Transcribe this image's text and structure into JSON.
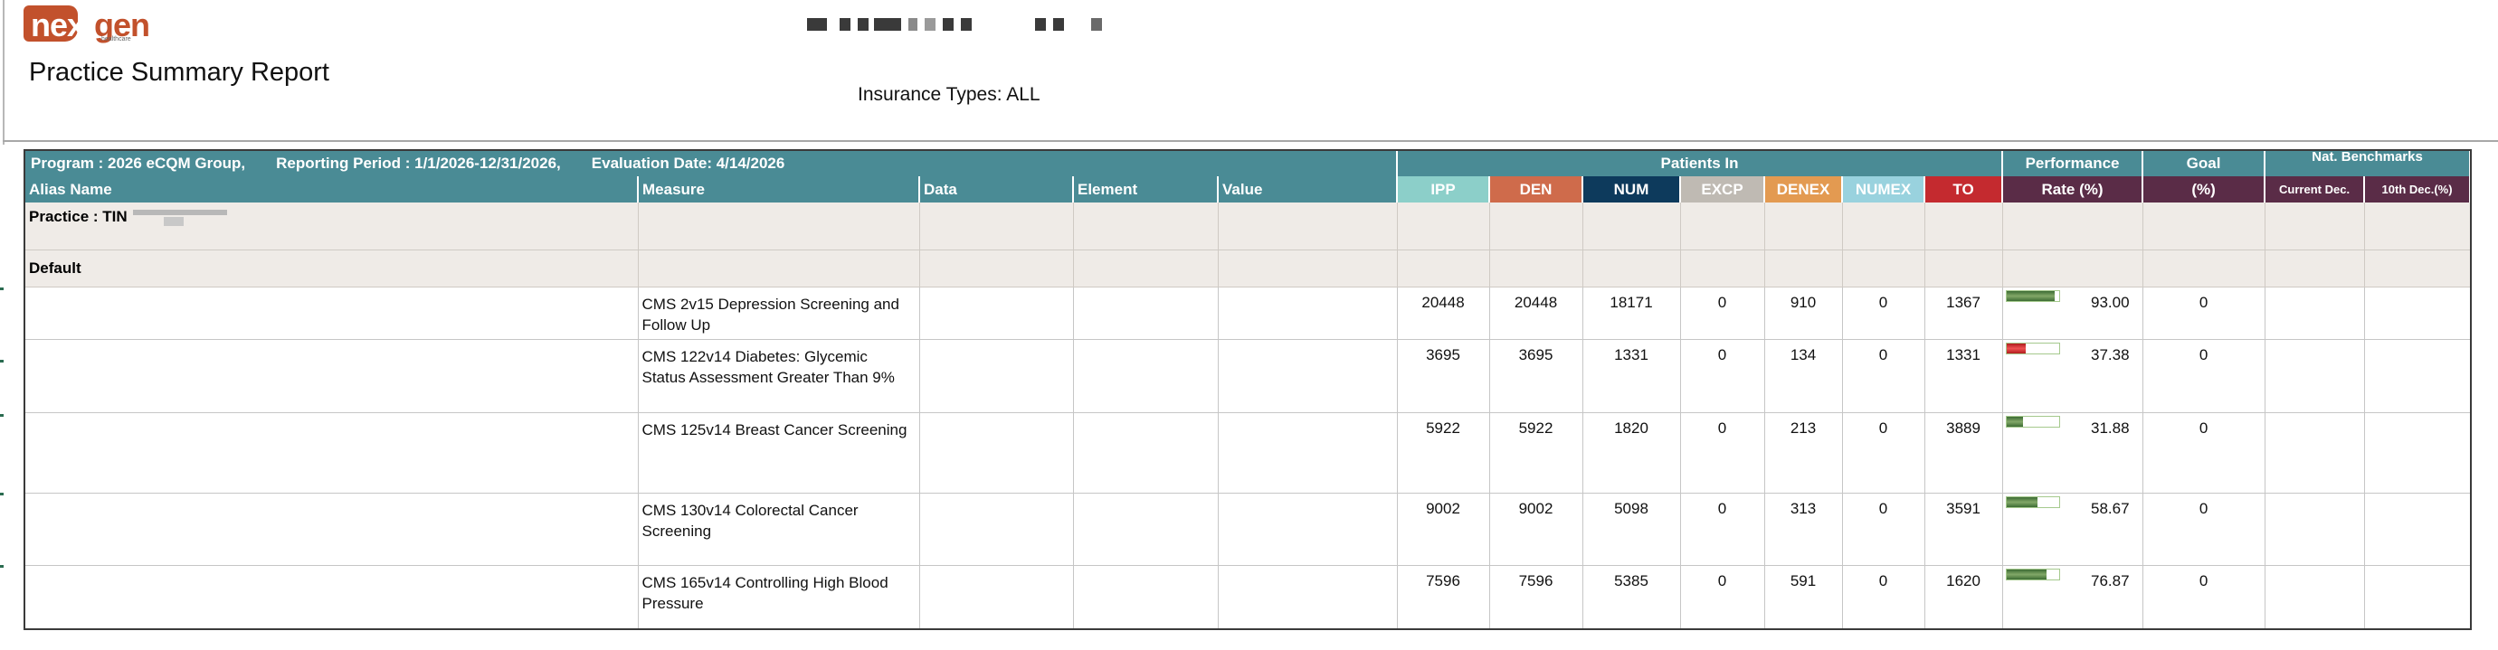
{
  "logo": {
    "part1": "next",
    "part2": "gen",
    "sub": "healthcare"
  },
  "report": {
    "title": "Practice Summary Report",
    "insurance": "Insurance Types: ALL"
  },
  "program_bar": {
    "program": "Program : 2026 eCQM Group,",
    "period": "Reporting Period : 1/1/2026-12/31/2026,",
    "evaluation": "Evaluation Date: 4/14/2026",
    "patients_in": "Patients In",
    "performance": "Performance",
    "goal": "Goal",
    "benchmarks": "Nat. Benchmarks"
  },
  "columns": {
    "alias": "Alias Name",
    "measure": "Measure",
    "data": "Data",
    "element": "Element",
    "value": "Value",
    "ipp": "IPP",
    "den": "DEN",
    "num": "NUM",
    "excp": "EXCP",
    "denex": "DENEX",
    "numex": "NUMEX",
    "to": "TO",
    "rate": "Rate (%)",
    "goal_pct": "(%)",
    "current_dec": "Current Dec.",
    "tenth_dec": "10th Dec.(%)"
  },
  "groups": {
    "practice": "Practice : TIN",
    "default": "Default"
  },
  "rows": [
    {
      "measure": "CMS 2v15 Depression Screening and Follow Up",
      "ipp": "20448",
      "den": "20448",
      "num": "18171",
      "excp": "0",
      "denex": "910",
      "numex": "0",
      "to": "1367",
      "rate": "93.00",
      "rate_fraction": 0.93,
      "rate_status": "good",
      "goal": "0"
    },
    {
      "measure": "CMS 122v14 Diabetes: Glycemic Status Assessment Greater Than 9%",
      "ipp": "3695",
      "den": "3695",
      "num": "1331",
      "excp": "0",
      "denex": "134",
      "numex": "0",
      "to": "1331",
      "rate": "37.38",
      "rate_fraction": 0.3738,
      "rate_status": "bad",
      "goal": "0"
    },
    {
      "measure": "CMS 125v14 Breast Cancer Screening",
      "ipp": "5922",
      "den": "5922",
      "num": "1820",
      "excp": "0",
      "denex": "213",
      "numex": "0",
      "to": "3889",
      "rate": "31.88",
      "rate_fraction": 0.3188,
      "rate_status": "good",
      "goal": "0"
    },
    {
      "measure": "CMS 130v14 Colorectal Cancer Screening",
      "ipp": "9002",
      "den": "9002",
      "num": "5098",
      "excp": "0",
      "denex": "313",
      "numex": "0",
      "to": "3591",
      "rate": "58.67",
      "rate_fraction": 0.5867,
      "rate_status": "good",
      "goal": "0"
    },
    {
      "measure": "CMS 165v14 Controlling High Blood Pressure",
      "ipp": "7596",
      "den": "7596",
      "num": "5385",
      "excp": "0",
      "denex": "591",
      "numex": "0",
      "to": "1620",
      "rate": "76.87",
      "rate_fraction": 0.7687,
      "rate_status": "good",
      "goal": "0"
    }
  ]
}
